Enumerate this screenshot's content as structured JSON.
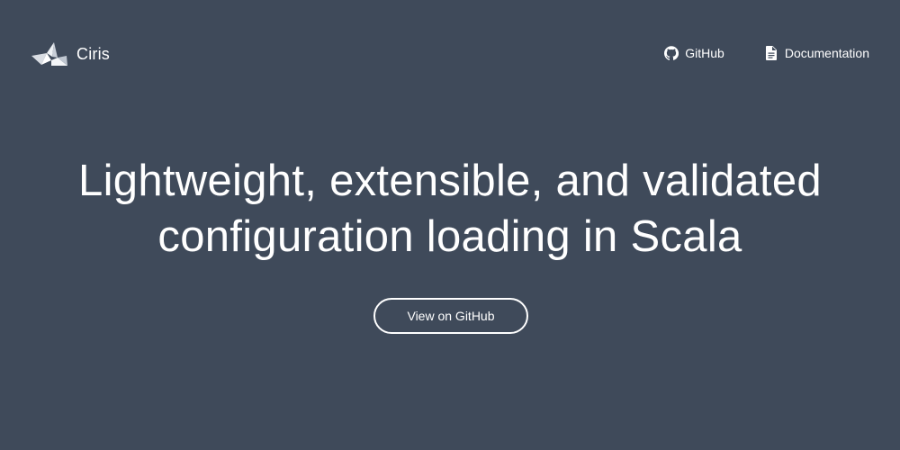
{
  "header": {
    "brand_name": "Ciris",
    "brand_icon": "origami-bird-logo-icon",
    "nav": [
      {
        "label": "GitHub",
        "icon": "github-icon"
      },
      {
        "label": "Documentation",
        "icon": "document-icon"
      }
    ]
  },
  "hero": {
    "title_line1": "Lightweight, extensible, and validated",
    "title_line2": "configuration loading in Scala",
    "cta_label": "View on GitHub"
  },
  "colors": {
    "background": "#3f4a5a",
    "text": "#ffffff"
  }
}
